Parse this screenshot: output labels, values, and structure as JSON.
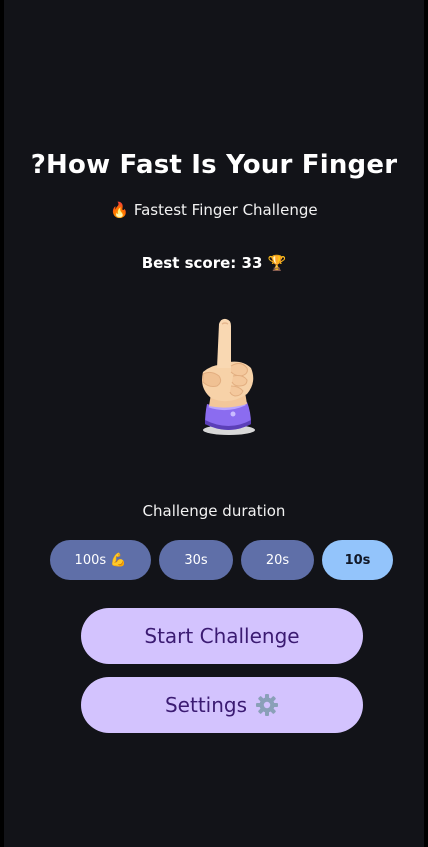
{
  "app": {
    "title": "?How Fast Is Your Finger",
    "subtitle": "🔥 Fastest Finger Challenge",
    "best_score": "Best score: 33 🏆",
    "hand_icon": "pointing-up-hand-icon"
  },
  "duration": {
    "label": "Challenge duration",
    "options": [
      "100s 💪",
      "30s",
      "20s",
      "10s"
    ],
    "selected": "10s"
  },
  "actions": {
    "start_label": "Start Challenge",
    "settings_label": "Settings",
    "settings_icon": "gear-icon"
  },
  "colors": {
    "background": "#121318",
    "chip": "#5f6fa8",
    "chip_selected": "#93c4fb",
    "button": "#d3c3fe",
    "button_text": "#3b1b72"
  }
}
